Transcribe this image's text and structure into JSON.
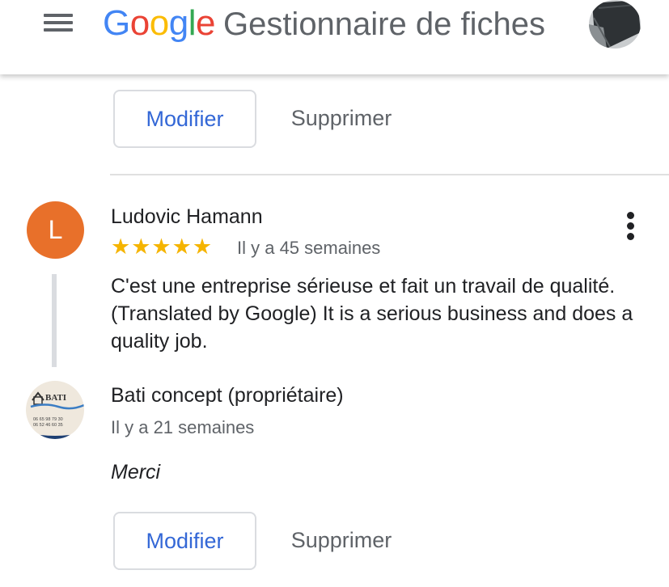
{
  "appbar": {
    "logo": {
      "G": "G",
      "o1": "o",
      "o2": "o",
      "g": "g",
      "l": "l",
      "e": "e"
    },
    "product_name": "Gestionnaire de fiches",
    "menu_icon": "hamburger-menu-icon",
    "account_icon": "account-avatar"
  },
  "colors": {
    "google_blue": "#4285f4",
    "google_red": "#ea4335",
    "google_yellow": "#fbbc05",
    "google_green": "#34a853",
    "link_blue": "#3367d6",
    "star_yellow": "#f5b400",
    "avatar_orange": "#e8702a"
  },
  "previous_reply_actions": {
    "edit_label": "Modifier",
    "delete_label": "Supprimer"
  },
  "review": {
    "avatar_initial": "L",
    "reviewer_name": "Ludovic Hamann",
    "rating": 5,
    "stars": "★★★★★",
    "date": "Il y a 45 semaines",
    "text": "C'est une entreprise sérieuse et fait un travail de qualité. (Translated by Google) It is a serious business and does a quality job.",
    "more_icon": "more-vert-icon"
  },
  "owner_reply": {
    "owner_name": "Bati concept (propriétaire)",
    "logo_text": "BATI",
    "logo_phone_1": "06 65 98 79 30",
    "logo_phone_2": "06 52 46 60 35",
    "date": "Il y a 21 semaines",
    "text": "Merci",
    "edit_label": "Modifier",
    "delete_label": "Supprimer"
  }
}
